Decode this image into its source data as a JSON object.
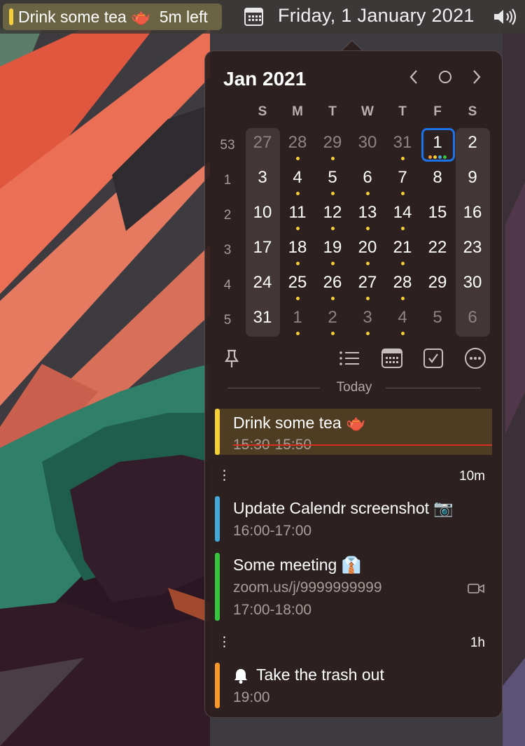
{
  "menubar": {
    "event_title": "Drink some tea 🫖",
    "event_time_left": "5m left",
    "date": "Friday, 1 January 2021",
    "calendar_icon": "calendar-icon",
    "volume_icon": "speaker-icon"
  },
  "calendar": {
    "month_title": "Jan 2021",
    "weekdays": [
      "S",
      "M",
      "T",
      "W",
      "T",
      "F",
      "S"
    ],
    "week_numbers": [
      "53",
      "1",
      "2",
      "3",
      "4",
      "5"
    ],
    "days": [
      [
        "27",
        "28",
        "29",
        "30",
        "31",
        "1",
        "2"
      ],
      [
        "3",
        "4",
        "5",
        "6",
        "7",
        "8",
        "9"
      ],
      [
        "10",
        "11",
        "12",
        "13",
        "14",
        "15",
        "16"
      ],
      [
        "17",
        "18",
        "19",
        "20",
        "21",
        "22",
        "23"
      ],
      [
        "24",
        "25",
        "26",
        "27",
        "28",
        "29",
        "30"
      ],
      [
        "31",
        "1",
        "2",
        "3",
        "4",
        "5",
        "6"
      ]
    ],
    "colors": {
      "today_ring": "#1c73e8",
      "event_dot": "#f5cf36"
    }
  },
  "toolbar": {
    "pin_icon": "pin-icon",
    "list_icon": "list-icon",
    "calendar_icon": "calendar-icon",
    "reminders_icon": "checkbox-icon",
    "more_icon": "ellipsis-icon"
  },
  "agenda": {
    "section_label": "Today",
    "events": [
      {
        "title": "Drink some tea 🫖",
        "subtitle": "15:30-15:50",
        "color": "#f5cf36"
      },
      {
        "title": "Update Calendr screenshot 📷",
        "subtitle": "16:00-17:00",
        "color": "#44a9d6"
      },
      {
        "title": "Some meeting 👔",
        "link": "zoom.us/j/9999999999",
        "subtitle": "17:00-18:00",
        "color": "#37c53f"
      },
      {
        "title": "Take the trash out",
        "subtitle": "19:00",
        "color": "#f79a2a"
      }
    ],
    "gaps": [
      "10m",
      "1h"
    ]
  }
}
